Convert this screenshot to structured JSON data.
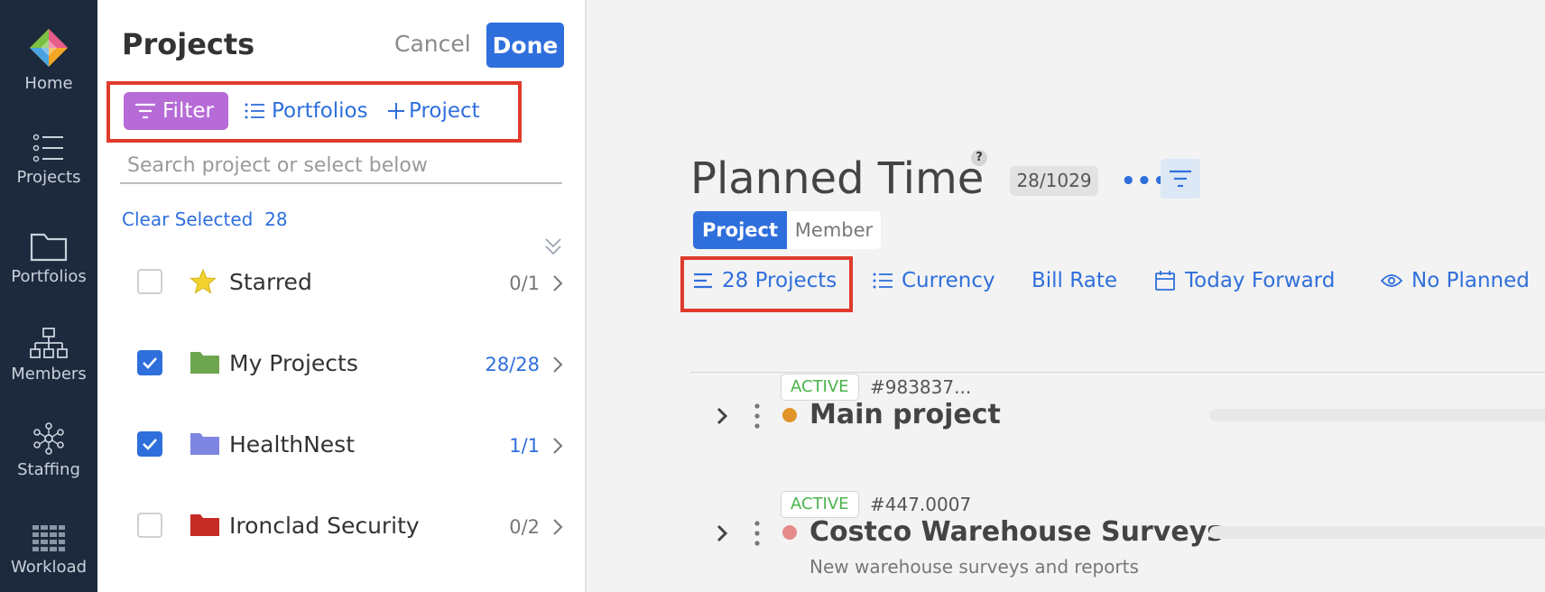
{
  "nav": {
    "items": [
      {
        "label": "Home",
        "icon": "home-logo-icon"
      },
      {
        "label": "Projects",
        "icon": "list-icon"
      },
      {
        "label": "Portfolios",
        "icon": "folder-icon"
      },
      {
        "label": "Members",
        "icon": "org-chart-icon"
      },
      {
        "label": "Staffing",
        "icon": "network-icon"
      },
      {
        "label": "Workload",
        "icon": "grid-icon"
      }
    ]
  },
  "panel": {
    "title": "Projects",
    "cancel_label": "Cancel",
    "done_label": "Done",
    "filter_label": "Filter",
    "portfolios_label": "Portfolios",
    "add_project_label": "Project",
    "search_placeholder": "Search project or select below",
    "clear_selected_label": "Clear Selected",
    "clear_selected_count": "28",
    "rows": [
      {
        "name": "Starred",
        "count": "0/1",
        "checked": false,
        "icon": "star-icon",
        "color": "#f2d22e"
      },
      {
        "name": "My Projects",
        "count": "28/28",
        "checked": true,
        "icon": "folder-icon",
        "color": "#6ea54f"
      },
      {
        "name": "HealthNest",
        "count": "1/1",
        "checked": true,
        "icon": "folder-icon",
        "color": "#7d86e0"
      },
      {
        "name": "Ironclad Security",
        "count": "0/2",
        "checked": false,
        "icon": "folder-icon",
        "color": "#c62a24"
      }
    ]
  },
  "main": {
    "title": "Planned Time",
    "help": "?",
    "count_pill": "28/1029",
    "more": "•••",
    "view_project": "Project",
    "view_member": "Member",
    "toolbar": {
      "projects": "28 Projects",
      "currency": "Currency",
      "bill_rate": "Bill Rate",
      "date_range": "Today Forward",
      "planned": "No Planned"
    },
    "projects": [
      {
        "status": "ACTIVE",
        "number": "#983837...",
        "name": "Main project",
        "description": "",
        "dot_color": "#e0942a"
      },
      {
        "status": "ACTIVE",
        "number": "#447.0007",
        "name": "Costco Warehouse Surveys",
        "description": "New warehouse surveys and reports",
        "dot_color": "#e58a8a"
      }
    ]
  },
  "colors": {
    "nav_bg": "#1d2a3d",
    "accent": "#2f6fdc",
    "filter_purple": "#b66bd6",
    "highlight_red": "#e03b2c",
    "active_green": "#4bb34b"
  }
}
